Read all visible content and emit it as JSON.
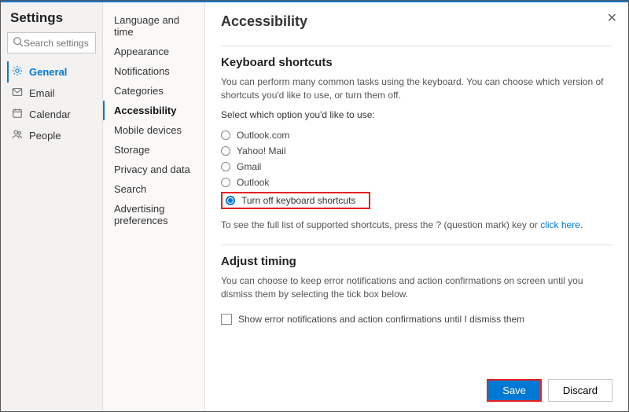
{
  "header": {
    "title": "Settings",
    "search_placeholder": "Search settings"
  },
  "categories": [
    {
      "label": "General",
      "icon": "gear"
    },
    {
      "label": "Email",
      "icon": "mail"
    },
    {
      "label": "Calendar",
      "icon": "calendar"
    },
    {
      "label": "People",
      "icon": "people"
    }
  ],
  "subnav": [
    {
      "label": "Language and time"
    },
    {
      "label": "Appearance"
    },
    {
      "label": "Notifications"
    },
    {
      "label": "Categories"
    },
    {
      "label": "Accessibility"
    },
    {
      "label": "Mobile devices"
    },
    {
      "label": "Storage"
    },
    {
      "label": "Privacy and data"
    },
    {
      "label": "Search"
    },
    {
      "label": "Advertising preferences"
    }
  ],
  "page": {
    "title": "Accessibility"
  },
  "shortcuts": {
    "heading": "Keyboard shortcuts",
    "desc": "You can perform many common tasks using the keyboard. You can choose which version of shortcuts you'd like to use, or turn them off.",
    "prompt": "Select which option you'd like to use:",
    "options": [
      "Outlook.com",
      "Yahoo! Mail",
      "Gmail",
      "Outlook",
      "Turn off keyboard shortcuts"
    ],
    "hint_prefix": "To see the full list of supported shortcuts, press the ? (question mark) key or ",
    "hint_link": "click here",
    "hint_suffix": "."
  },
  "timing": {
    "heading": "Adjust timing",
    "desc": "You can choose to keep error notifications and action confirmations on screen until you dismiss them by selecting the tick box below.",
    "checkbox_label": "Show error notifications and action confirmations until I dismiss them"
  },
  "footer": {
    "save": "Save",
    "discard": "Discard"
  }
}
